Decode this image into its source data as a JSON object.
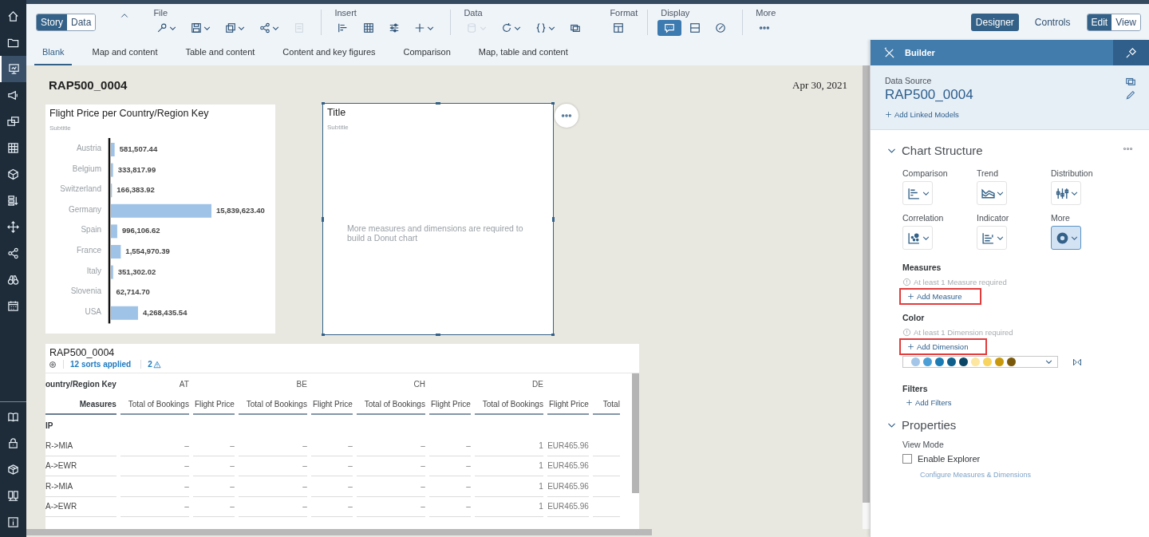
{
  "nav": {
    "top": [
      {
        "kind": "house",
        "selected": false
      },
      {
        "kind": "folder",
        "selected": false
      },
      {
        "kind": "easel",
        "selected": true
      },
      {
        "kind": "megaphone",
        "selected": false
      },
      {
        "kind": "screens",
        "selected": false
      },
      {
        "kind": "table",
        "selected": false
      },
      {
        "kind": "cube",
        "selected": false
      },
      {
        "kind": "list-arrow",
        "selected": false
      },
      {
        "kind": "arrows",
        "selected": false
      },
      {
        "kind": "share",
        "selected": false
      },
      {
        "kind": "binoculars",
        "selected": false
      },
      {
        "kind": "calendar",
        "selected": false
      }
    ],
    "bottom": [
      {
        "kind": "book",
        "selected": false
      },
      {
        "kind": "lock",
        "selected": false
      },
      {
        "kind": "boxes",
        "selected": false
      },
      {
        "kind": "panels",
        "selected": false
      },
      {
        "kind": "info",
        "selected": false
      }
    ]
  },
  "mode_toggle": [
    {
      "label": "Story",
      "selected": true
    },
    {
      "label": "Data",
      "selected": false
    }
  ],
  "toolbar": [
    {
      "label": "File",
      "tools": [
        {
          "kind": "wrench",
          "dropdown": true,
          "disabled": false,
          "selected": false
        },
        {
          "kind": "save",
          "dropdown": true,
          "disabled": false,
          "selected": false
        },
        {
          "kind": "copy",
          "dropdown": true,
          "disabled": false,
          "selected": false
        },
        {
          "kind": "share",
          "dropdown": true,
          "disabled": false,
          "selected": false
        },
        {
          "kind": "doc",
          "dropdown": false,
          "disabled": true,
          "selected": false
        }
      ]
    },
    {
      "label": "Insert",
      "tools": [
        {
          "kind": "bar-chart",
          "dropdown": false,
          "disabled": false,
          "selected": false
        },
        {
          "kind": "table",
          "dropdown": false,
          "disabled": false,
          "selected": false
        },
        {
          "kind": "sliders",
          "dropdown": false,
          "disabled": false,
          "selected": false
        },
        {
          "kind": "plus",
          "dropdown": true,
          "disabled": false,
          "selected": false
        }
      ]
    },
    {
      "label": "Data",
      "tools": [
        {
          "kind": "database",
          "dropdown": true,
          "disabled": true,
          "selected": false
        },
        {
          "kind": "refresh",
          "dropdown": true,
          "disabled": false,
          "selected": false
        },
        {
          "kind": "braces",
          "dropdown": true,
          "disabled": false,
          "selected": false
        },
        {
          "kind": "windows",
          "dropdown": false,
          "disabled": false,
          "selected": false
        }
      ]
    },
    {
      "label": "Format",
      "tools": [
        {
          "kind": "layout",
          "dropdown": false,
          "disabled": false,
          "selected": false
        }
      ]
    },
    {
      "label": "Display",
      "tools": [
        {
          "kind": "comment",
          "dropdown": false,
          "disabled": false,
          "selected": true
        },
        {
          "kind": "panel",
          "dropdown": false,
          "disabled": false,
          "selected": false
        },
        {
          "kind": "compass",
          "dropdown": false,
          "disabled": false,
          "selected": false
        }
      ]
    },
    {
      "label": "More",
      "tools": [
        {
          "kind": "dots",
          "dropdown": false,
          "disabled": false,
          "selected": false
        }
      ]
    }
  ],
  "role_toggle": [
    {
      "label": "Designer",
      "selected": true
    },
    {
      "label": "Controls",
      "selected": false
    }
  ],
  "edit_toggle": [
    {
      "label": "Edit",
      "selected": true
    },
    {
      "label": "View",
      "selected": false
    }
  ],
  "tabs": [
    {
      "label": "Blank",
      "selected": true
    },
    {
      "label": "Map and content",
      "selected": false
    },
    {
      "label": "Table and content",
      "selected": false
    },
    {
      "label": "Content and key figures",
      "selected": false
    },
    {
      "label": "Comparison",
      "selected": false
    },
    {
      "label": "Map, table and content",
      "selected": false
    }
  ],
  "page": {
    "title": "RAP500_0004",
    "date": "Apr 30, 2021"
  },
  "bar_widget": {
    "title": "Flight Price per Country/Region Key",
    "subtitle": "Subtitle",
    "chart_data": {
      "type": "bar",
      "orientation": "horizontal",
      "categories": [
        "Austria",
        "Belgium",
        "Switzerland",
        "Germany",
        "Spain",
        "France",
        "Italy",
        "Slovenia",
        "USA"
      ],
      "values": [
        581507.44,
        333817.99,
        166383.92,
        15839623.4,
        996106.62,
        1554970.39,
        351302.02,
        62714.7,
        4268435.54
      ],
      "value_labels": [
        "581,507.44",
        "333,817.99",
        "166,383.92",
        "15,839,623.40",
        "996,106.62",
        "1,554,970.39",
        "351,302.02",
        "62,714.70",
        "4,268,435.54"
      ]
    }
  },
  "donut_widget": {
    "title": "Title",
    "subtitle": "Subtitle",
    "message": "More measures and dimensions are required to build a Donut chart",
    "selected": true
  },
  "table_widget": {
    "title": "RAP500_0004",
    "sorts": "12 sorts applied",
    "warnings": "2",
    "corner": "ountry/Region Key",
    "measures_label": "Measures",
    "groups": [
      "AT",
      "BE",
      "CH",
      "DE"
    ],
    "columns": [
      "Total of Bookings",
      "Flight Price",
      "Total of Bookings",
      "Flight Price",
      "Total of Bookings",
      "Flight Price",
      "Total of Bookings",
      "Flight Price",
      "Total"
    ],
    "section": "IP",
    "rows": [
      {
        "label": "R->MIA",
        "cells": [
          "–",
          "–",
          "–",
          "–",
          "–",
          "–",
          "1",
          "EUR465.96"
        ]
      },
      {
        "label": "A->EWR",
        "cells": [
          "–",
          "–",
          "–",
          "–",
          "–",
          "–",
          "1",
          "EUR465.96"
        ]
      },
      {
        "label": "R->MIA",
        "cells": [
          "–",
          "–",
          "–",
          "–",
          "–",
          "–",
          "1",
          "EUR465.96"
        ]
      },
      {
        "label": "A->EWR",
        "cells": [
          "–",
          "–",
          "–",
          "–",
          "–",
          "–",
          "1",
          "EUR465.96"
        ]
      }
    ]
  },
  "builder": {
    "title": "Builder",
    "data_source_label": "Data Source",
    "data_source": "RAP500_0004",
    "add_linked": "Add Linked Models",
    "chart_structure": {
      "title": "Chart Structure",
      "expanded": true,
      "types": [
        {
          "label": "Comparison",
          "kind": "bar",
          "selected": false
        },
        {
          "label": "Trend",
          "kind": "area",
          "selected": false
        },
        {
          "label": "Distribution",
          "kind": "boxplot",
          "selected": false
        },
        {
          "label": "Correlation",
          "kind": "scatter",
          "selected": false
        },
        {
          "label": "Indicator",
          "kind": "indicator",
          "selected": false
        },
        {
          "label": "More",
          "kind": "donut",
          "selected": true
        }
      ],
      "measures": {
        "title": "Measures",
        "note": "At least 1 Measure required",
        "action": "Add Measure"
      },
      "color": {
        "title": "Color",
        "note": "At least 1 Dimension required",
        "action": "Add Dimension",
        "palette": [
          {
            "color": "#a3c6e8"
          },
          {
            "color": "#4a9fd6"
          },
          {
            "color": "#1b7bb4"
          },
          {
            "color": "#0f5f8c"
          },
          {
            "color": "#0a4566"
          },
          {
            "color": "#fde6a0"
          },
          {
            "color": "#f8d35e"
          },
          {
            "color": "#c8980c"
          },
          {
            "color": "#7a5a0a"
          }
        ]
      },
      "filters": {
        "title": "Filters",
        "action": "Add Filters"
      }
    },
    "properties": {
      "title": "Properties",
      "expanded": true,
      "view_mode": "View Mode",
      "explorer": {
        "label": "Enable Explorer",
        "checked": false
      },
      "configure": "Configure Measures & Dimensions"
    }
  }
}
